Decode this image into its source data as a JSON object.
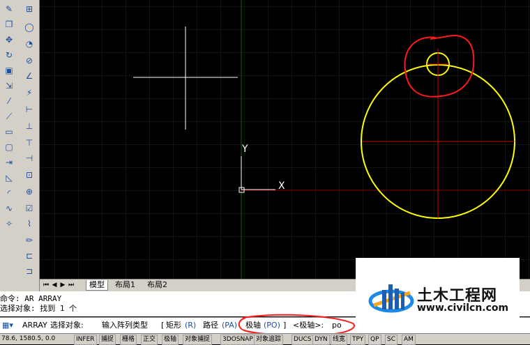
{
  "tabs": {
    "model": "模型",
    "layout1": "布局1",
    "layout2": "布局2"
  },
  "command_history": {
    "line1": "命令: AR ARRAY",
    "line2": "选择对象: 找到 1 个"
  },
  "command_input": {
    "command": "ARRAY",
    "prompt": "选择对象:",
    "prompt2": "输入阵列类型",
    "rect_label": "矩形",
    "rect_key": "(R)",
    "path_label": "路径",
    "path_key": "(PA)",
    "polar_label": "极轴",
    "polar_key": "(PO)",
    "default": "<极轴>:",
    "typed": "po"
  },
  "statusbar": {
    "coords": "78.6, 1580.5, 0.0",
    "snap": "捕捉",
    "grid": "栅格",
    "ortho": "正交",
    "polar": "极轴",
    "osnap": "对象捕捉",
    "snap3d": "3DOSNAP",
    "otrack": "对象追踪",
    "ducs": "DUCS",
    "dyn": "DYN",
    "lwt": "线宽",
    "tpy": "TPY",
    "qp": "QP",
    "sc": "SC",
    "am": "AM",
    "infer": "INFER"
  },
  "ucs": {
    "y_label": "Y",
    "x_label": "X"
  },
  "watermark": {
    "title": "土木工程网",
    "url": "www.civilcn.com"
  },
  "colors": {
    "yellow": "#ffff00",
    "red_annotation": "#ff1a1a",
    "grid": "#1a2a1a",
    "crosshair": "#ffffff",
    "axis_red": "#b00000",
    "axis_green": "#006000"
  }
}
